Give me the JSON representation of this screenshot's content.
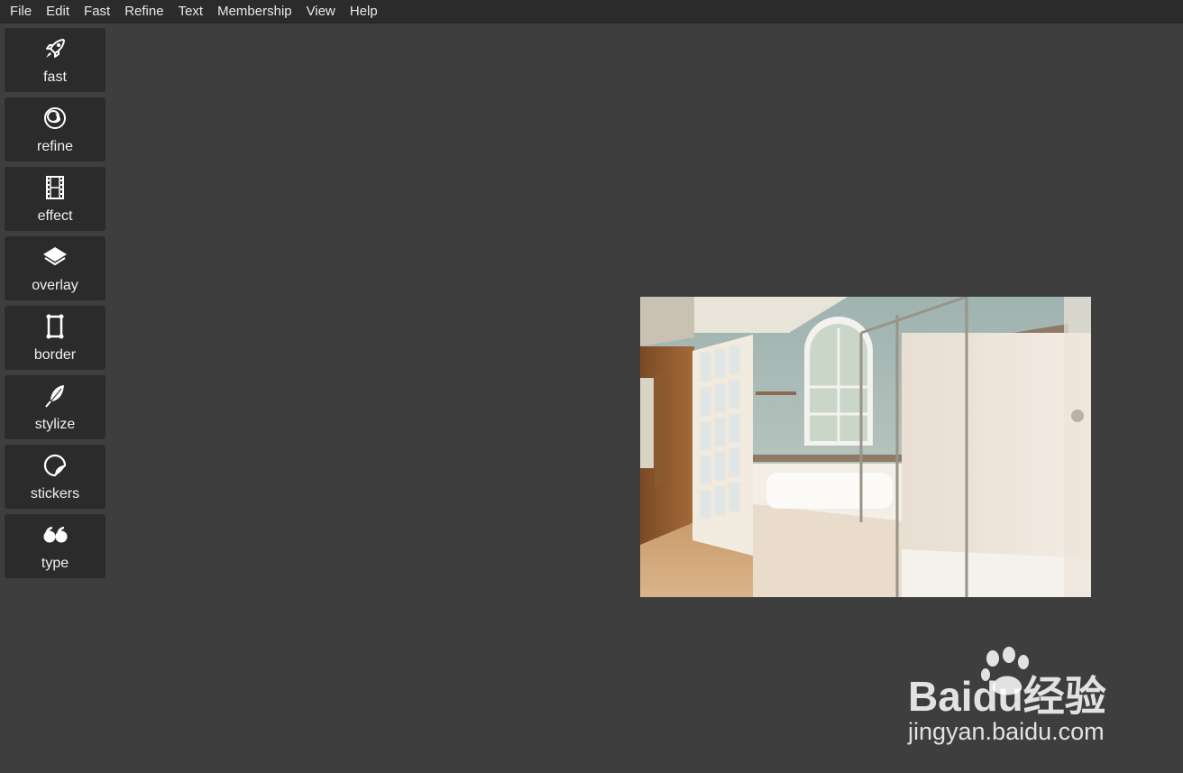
{
  "menu": [
    "File",
    "Edit",
    "Fast",
    "Refine",
    "Text",
    "Membership",
    "View",
    "Help"
  ],
  "tools": [
    {
      "name": "fast",
      "label": "fast",
      "icon": "rocket-icon"
    },
    {
      "name": "refine",
      "label": "refine",
      "icon": "refine-circles-icon"
    },
    {
      "name": "effect",
      "label": "effect",
      "icon": "film-strip-icon"
    },
    {
      "name": "overlay",
      "label": "overlay",
      "icon": "layers-icon"
    },
    {
      "name": "border",
      "label": "border",
      "icon": "frame-icon"
    },
    {
      "name": "stylize",
      "label": "stylize",
      "icon": "feather-icon"
    },
    {
      "name": "stickers",
      "label": "stickers",
      "icon": "sticker-icon"
    },
    {
      "name": "type",
      "label": "type",
      "icon": "quote-icon"
    }
  ],
  "canvas": {
    "photo": "bathroom-photo"
  },
  "watermark": {
    "brand": "Baidu经验",
    "url": "jingyan.baidu.com"
  },
  "colors": {
    "background": "#3e3e3e",
    "panel": "#2b2b2b",
    "text": "#f0f0f0"
  }
}
